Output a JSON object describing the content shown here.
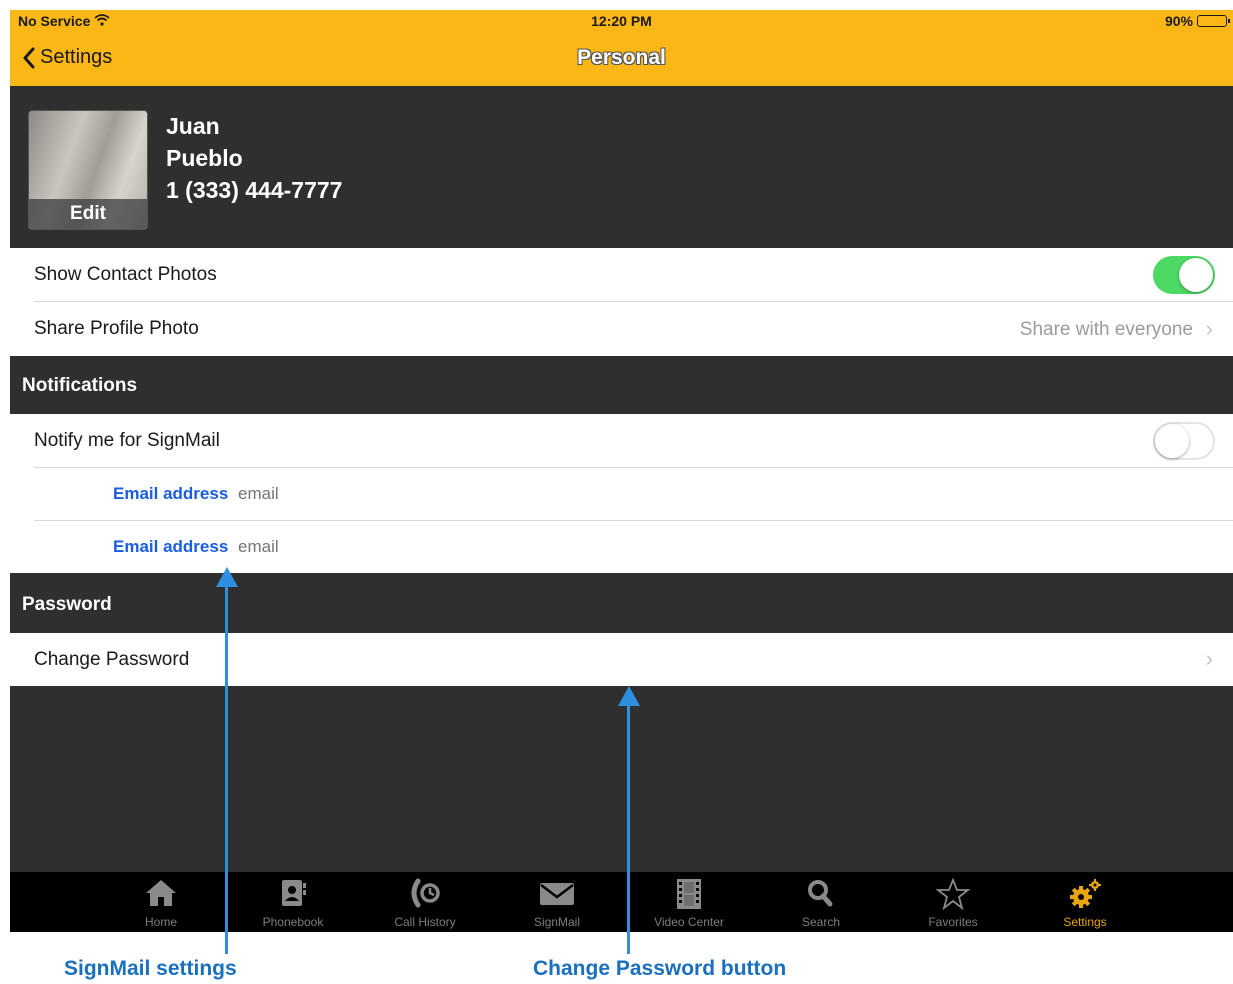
{
  "status_bar": {
    "carrier": "No Service",
    "time": "12:20 PM",
    "battery": "90%"
  },
  "nav": {
    "back_label": "Settings",
    "title": "Personal"
  },
  "profile": {
    "photo_edit_label": "Edit",
    "first_name": "Juan",
    "last_name": "Pueblo",
    "phone": "1 (333) 444-7777"
  },
  "rows": {
    "show_contact_photos": {
      "label": "Show Contact Photos",
      "toggle_on": true
    },
    "share_profile_photo": {
      "label": "Share Profile Photo",
      "value": "Share with everyone"
    }
  },
  "notifications": {
    "header": "Notifications",
    "notify_signmail": {
      "label": "Notify me for SignMail",
      "toggle_on": false
    },
    "email_1": {
      "label": "Email address",
      "placeholder": "email"
    },
    "email_2": {
      "label": "Email address",
      "placeholder": "email"
    }
  },
  "password": {
    "header": "Password",
    "change_label": "Change Password"
  },
  "tabbar": {
    "tabs": [
      {
        "label": "Home",
        "icon": "home-icon"
      },
      {
        "label": "Phonebook",
        "icon": "phonebook-icon"
      },
      {
        "label": "Call History",
        "icon": "call-history-icon"
      },
      {
        "label": "SignMail",
        "icon": "envelope-icon"
      },
      {
        "label": "Video Center",
        "icon": "film-icon"
      },
      {
        "label": "Search",
        "icon": "search-icon"
      },
      {
        "label": "Favorites",
        "icon": "star-icon"
      },
      {
        "label": "Settings",
        "icon": "gear-icon"
      }
    ],
    "active": "Settings",
    "active_color": "#e8a50c"
  },
  "callouts": {
    "signmail": "SignMail settings",
    "password": "Change Password button"
  },
  "colors": {
    "header": "#fbb716",
    "dark": "#2f2f2f",
    "toggle_on": "#4cd964",
    "link_blue": "#1a5de0",
    "callout_blue": "#2e8fe0"
  }
}
